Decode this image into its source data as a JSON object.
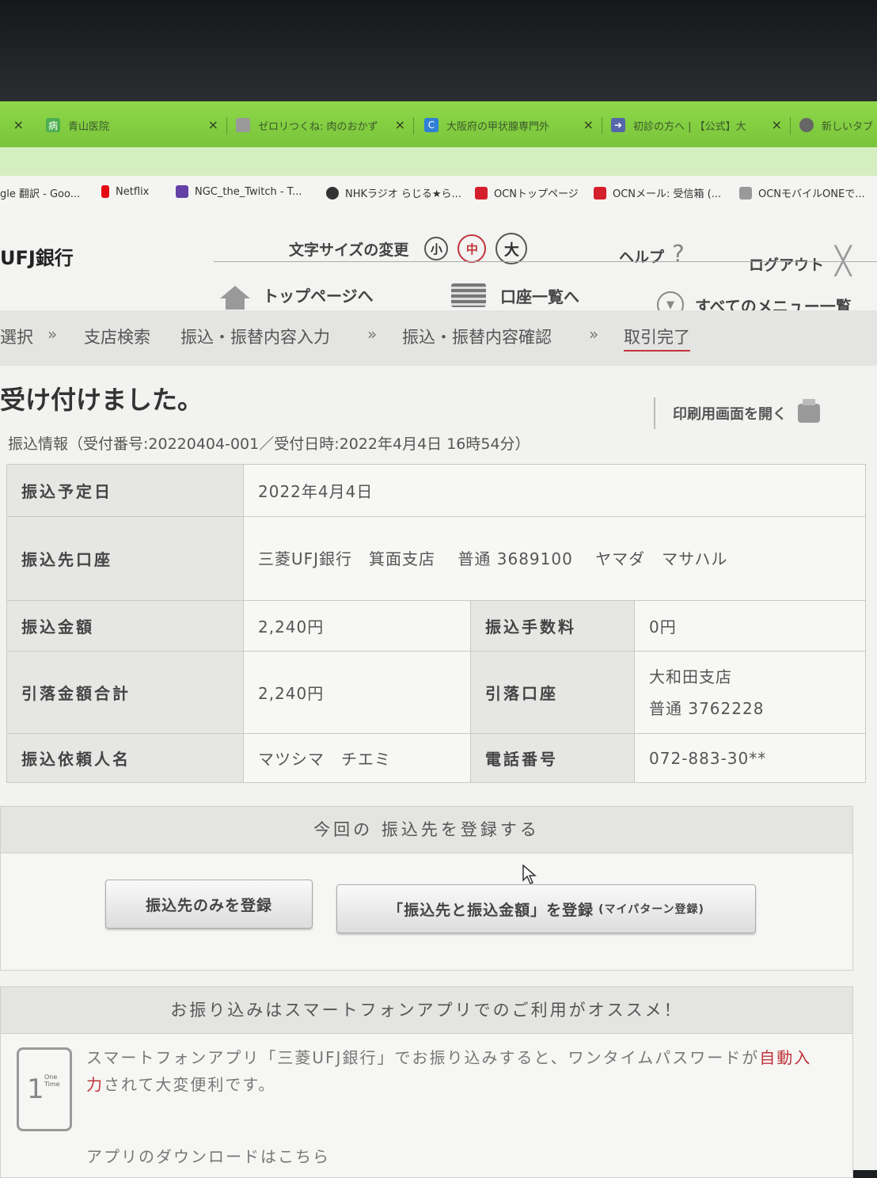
{
  "tabs": [
    {
      "icon": "hospital-icon",
      "label": "青山医院",
      "color": "#4caf50"
    },
    {
      "icon": "recipe-icon",
      "label": "ゼロリつくね: 肉のおかず",
      "color": "#888888"
    },
    {
      "icon": "clinic-icon",
      "label": "大阪府の甲状腺専門外",
      "color": "#2f7fd6"
    },
    {
      "icon": "arrow-icon",
      "label": "初診の方へ | 【公式】大",
      "color": "#5566aa"
    },
    {
      "icon": "new-tab-icon",
      "label": "新しいタブ",
      "color": "#666666"
    }
  ],
  "bookmarks": [
    {
      "label": "gle 翻訳 - Goo...",
      "color": "#4285f4"
    },
    {
      "label": "Netflix",
      "color": "#e50914"
    },
    {
      "label": "NGC_the_Twitch - T...",
      "color": "#6441a5"
    },
    {
      "label": "NHKラジオ らじる★ら...",
      "color": "#333333"
    },
    {
      "label": "OCNトップページ",
      "color": "#d4202c"
    },
    {
      "label": "OCNメール: 受信箱 (...",
      "color": "#d4202c"
    },
    {
      "label": "OCNモバイルONEで...",
      "color": "#888888"
    }
  ],
  "header": {
    "logo": "UFJ銀行",
    "font_size_label": "文字サイズの変更",
    "size_small": "小",
    "size_medium": "中",
    "size_large": "大",
    "help": "ヘルプ",
    "logout": "ログアウト"
  },
  "nav": {
    "top": "トップページへ",
    "accounts": "口座一覧へ",
    "menu": "すべてのメニュー一覧"
  },
  "breadcrumb": [
    "選択",
    "支店検索",
    "振込・振替内容入力",
    "振込・振替内容確認",
    "取引完了"
  ],
  "main": {
    "done": "受け付けました。",
    "print": "印刷用画面を開く",
    "info": "振込情報（受付番号:20220404-001／受付日時:2022年4月4日 16時54分）"
  },
  "table": {
    "date_label": "振込予定日",
    "date_value": "2022年4月4日",
    "dest_label": "振込先口座",
    "dest_value": "三菱UFJ銀行　箕面支店　 普通 3689100 　ヤマダ　マサハル",
    "amount_label": "振込金額",
    "amount_value": "2,240円",
    "fee_label": "振込手数料",
    "fee_value": "0円",
    "total_label": "引落金額合計",
    "total_value": "2,240円",
    "debit_label": "引落口座",
    "debit_branch": "大和田支店",
    "debit_acct": "普通 3762228",
    "sender_label": "振込依頼人名",
    "sender_value": "マツシマ　チエミ",
    "phone_label": "電話番号",
    "phone_value": "072-883-30**"
  },
  "register": {
    "title": "今回の 振込先を登録する",
    "btn_dest_only": "振込先のみを登録",
    "btn_dest_amount": "「振込先と振込金額」を登録",
    "btn_dest_amount_note": "(マイパターン登録)"
  },
  "app": {
    "title": "お振り込みはスマートフォンアプリでのご利用がオススメ！",
    "text_a": "スマートフォンアプリ「三菱UFJ銀行」でお振り込みすると、ワンタイムパスワードが",
    "text_red": "自動入力",
    "text_b": "されて大変便利です。",
    "download": "アプリのダウンロードはこちら",
    "phone_num": "1",
    "phone_ot": "One Time"
  }
}
